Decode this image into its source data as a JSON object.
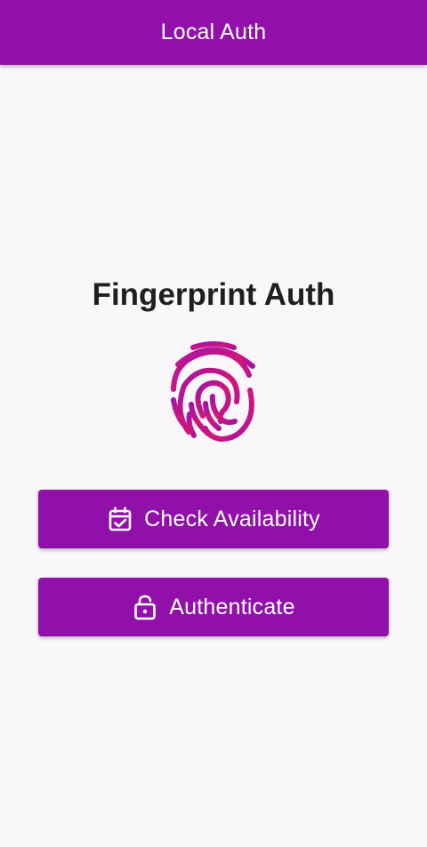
{
  "app_bar": {
    "title": "Local Auth"
  },
  "main": {
    "title": "Fingerprint Auth",
    "fingerprint_icon": "fingerprint-icon",
    "buttons": [
      {
        "label": "Check Availability",
        "icon": "calendar-check-icon"
      },
      {
        "label": "Authenticate",
        "icon": "lock-open-icon"
      }
    ]
  },
  "colors": {
    "primary": "#9110aa",
    "background": "#faf7fb",
    "title_text": "#1f1f1f",
    "fingerprint_start": "#b0169a",
    "fingerprint_end": "#d8146a"
  }
}
